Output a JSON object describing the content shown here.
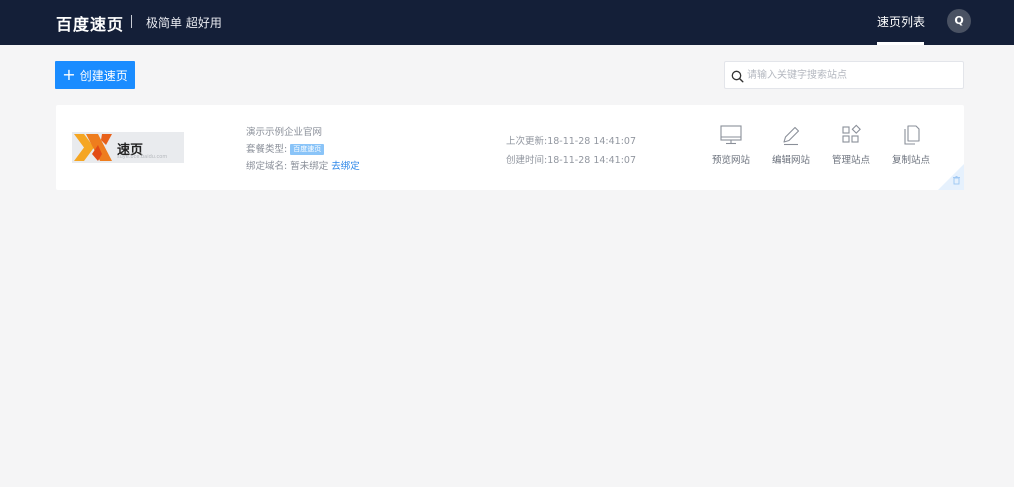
{
  "header": {
    "brand": "百度速页",
    "slogan": "极简单 超好用",
    "nav_active": "速页列表",
    "avatar_letter": "Q"
  },
  "toolbar": {
    "create_label": "创建速页",
    "search_placeholder": "请输入关键字搜索站点"
  },
  "site": {
    "logo_text": "速页",
    "logo_subtext": "suye.bce.baidu.com",
    "name": "演示示例企业官网",
    "plan_label": "套餐类型:",
    "plan_badge": "百度速页",
    "domain_label": "绑定域名:",
    "domain_value": "暂未绑定",
    "domain_action": "去绑定",
    "updated": "上次更新:18-11-28 14:41:07",
    "created": "创建时间:18-11-28 14:41:07",
    "actions": {
      "preview": "预览网站",
      "edit": "编辑网站",
      "manage": "管理站点",
      "copy": "复制站点"
    }
  },
  "colors": {
    "header_bg": "#141f38",
    "primary": "#1a8cff",
    "link": "#2b86e8",
    "badge": "#8ac4f8",
    "logo_orange": "#f08a24"
  }
}
